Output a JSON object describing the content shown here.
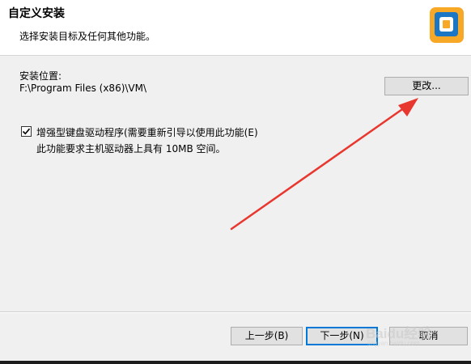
{
  "header": {
    "title": "自定义安装",
    "subtitle": "选择安装目标及任何其他功能。",
    "logo_icon": "vmware-logo-icon",
    "logo_colors": [
      "#f7a826",
      "#1b76c3"
    ]
  },
  "install": {
    "label": "安装位置:",
    "path": "F:\\Program Files (x86)\\VM\\",
    "change_button": "更改..."
  },
  "enhanced_keyboard": {
    "checked": true,
    "label": "增强型键盘驱动程序(需要重新引导以使用此功能(E)",
    "description": "此功能要求主机驱动器上具有 10MB 空间。"
  },
  "annotation": {
    "type": "red-arrow",
    "color": "#e8372f",
    "points_to": "change_button"
  },
  "footer": {
    "back_button": "上一步(B)",
    "next_button": "下一步(N)",
    "cancel_button": "取消"
  },
  "watermark": {
    "text": "Baidu经验",
    "url": "jingyan.baidu.com"
  }
}
